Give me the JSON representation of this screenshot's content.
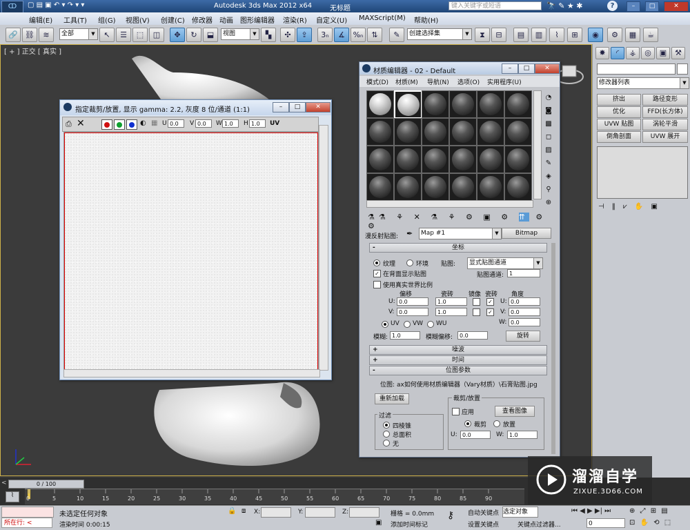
{
  "app": {
    "title": "Autodesk 3ds Max  2012 x64",
    "file": "无标题",
    "search_placeholder": "键入关键字或短语"
  },
  "menu": [
    "编辑(E)",
    "工具(T)",
    "组(G)",
    "视图(V)",
    "创建(C)",
    "修改器",
    "动画",
    "图形编辑器",
    "渲染(R)",
    "自定义(U)",
    "MAXScript(M)",
    "帮助(H)"
  ],
  "toolbar": {
    "select_filter": "全部",
    "ref_coord": "视图",
    "selection_set": "创建选择集"
  },
  "viewport": {
    "label": "[ + ] 正交 [ 真实 ]"
  },
  "command_panel": {
    "modifier_list": "修改器列表",
    "buttons": [
      "挤出",
      "路径变形",
      "优化",
      "FFD(长方体)",
      "UVW 贴图",
      "涡轮平滑",
      "倒角剖面",
      "UVW 展开"
    ]
  },
  "texture_window": {
    "title": "指定裁剪/放置, 显示 gamma: 2.2, 灰度 8 位/通道 (1:1)",
    "u_label": "U",
    "u_value": "0.0",
    "v_label": "V",
    "v_value": "0.0",
    "w_label": "W",
    "w_value": "1.0",
    "h_label": "H",
    "h_value": "1.0",
    "uv_label": "UV",
    "colors": {
      "red": "#d01010",
      "green": "#10a030",
      "blue": "#1030d0"
    }
  },
  "material_editor": {
    "title": "材质编辑器 - 02 - Default",
    "menus": [
      "模式(D)",
      "材质(M)",
      "导航(N)",
      "选项(O)",
      "实用程序(U)"
    ],
    "map_label": "漫反射贴图:",
    "map_name": "Map #1",
    "map_type": "Bitmap",
    "coords": {
      "header": "坐标",
      "texture": "纹理",
      "environ": "环境",
      "mapping_label": "贴图:",
      "mapping_value": "显式贴图通道",
      "show_back": "在背面显示贴图",
      "map_channel_label": "贴图通道:",
      "map_channel_value": "1",
      "real_world": "使用真实世界比例",
      "col_offset": "偏移",
      "col_tiling": "瓷砖",
      "col_mirror": "镜像",
      "col_tile": "瓷砖",
      "col_angle": "角度",
      "u_label": "U:",
      "v_label": "V:",
      "w_label": "W:",
      "u_offset": "0.0",
      "v_offset": "0.0",
      "u_tiling": "1.0",
      "v_tiling": "1.0",
      "u_angle": "0.0",
      "v_angle": "0.0",
      "w_angle": "0.0",
      "uv": "UV",
      "vw": "VW",
      "wu": "WU",
      "blur_label": "模糊:",
      "blur_value": "1.0",
      "blur_offset_label": "模糊偏移:",
      "blur_offset_value": "0.0",
      "rotate": "旋转"
    },
    "noise_header": "噪波",
    "time_header": "时间",
    "bitmap_params": {
      "header": "位图参数",
      "bitmap_label": "位图:",
      "bitmap_path": "ax如何使用材质编辑器（Vary材质）\\石膏贴图.jpg",
      "reload": "重新加载",
      "crop_header": "裁剪/放置",
      "apply": "应用",
      "view_image": "查看图像",
      "crop": "裁剪",
      "place": "放置",
      "filter_header": "过滤",
      "pyramidal": "四棱锥",
      "summed_area": "总面积",
      "none": "无",
      "u_label": "U:",
      "u_value": "0.0",
      "w_label": "W:",
      "w_value": "1.0"
    }
  },
  "timeline": {
    "range": "0 / 100",
    "ticks": [
      "0",
      "5",
      "10",
      "15",
      "20",
      "25",
      "30",
      "35",
      "40",
      "45",
      "50",
      "55",
      "60",
      "65",
      "70",
      "75",
      "80",
      "85",
      "90"
    ]
  },
  "status": {
    "running": "所在行:",
    "selection": "未选定任何对象",
    "render_time": "渲染时间  0:00:15",
    "x_label": "X:",
    "y_label": "Y:",
    "z_label": "Z:",
    "grid": "栅格 = 0.0mm",
    "add_time_tag": "添加时间标记",
    "auto_key": "自动关键点",
    "set_key": "设置关键点",
    "selected_obj": "选定对象",
    "key_filters": "关键点过滤器...",
    "frame": "0"
  },
  "watermark": {
    "name": "溜溜自学",
    "url": "ZIXUE.3D66.COM"
  }
}
